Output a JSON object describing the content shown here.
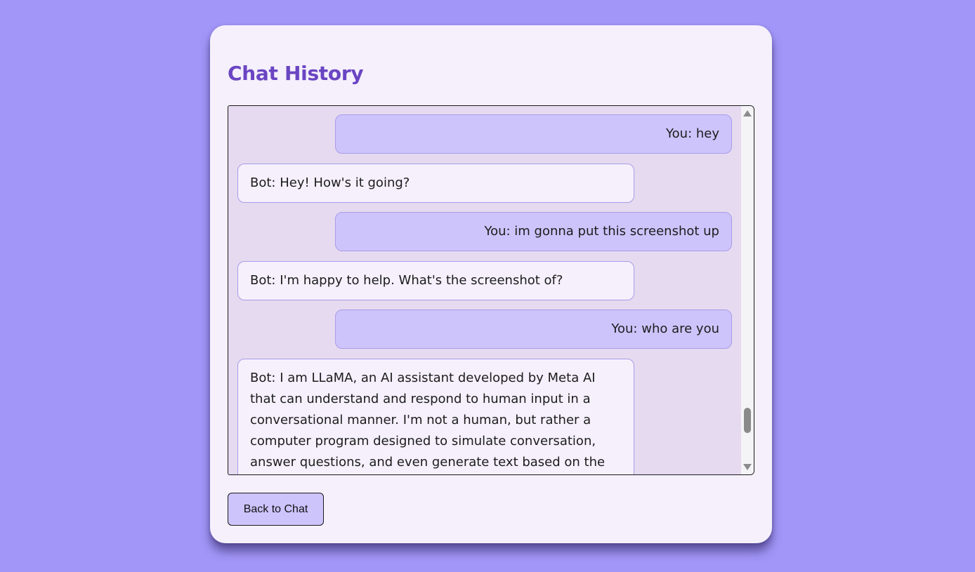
{
  "page": {
    "title": "Chat History"
  },
  "messages": [
    {
      "role": "user",
      "text": "You: hey"
    },
    {
      "role": "bot",
      "text": "Bot: Hey! How's it going?"
    },
    {
      "role": "user",
      "text": "You: im gonna put this screenshot up"
    },
    {
      "role": "bot",
      "text": "Bot: I'm happy to help. What's the screenshot of?"
    },
    {
      "role": "user",
      "text": "You: who are you"
    },
    {
      "role": "bot",
      "text": "Bot: I am LLaMA, an AI assistant developed by Meta AI that can understand and respond to human input in a conversational manner. I'm not a human, but rather a computer program designed to simulate conversation, answer questions, and even generate text based on the"
    }
  ],
  "actions": {
    "back_label": "Back to Chat"
  },
  "colors": {
    "background": "#a297f8",
    "card": "#f5f0fc",
    "title": "#6a45c2",
    "history_bg": "#e6daf0",
    "user_bubble": "#cec4fc",
    "bot_bubble": "#f5f0fc",
    "bubble_border": "#a99ce8"
  }
}
